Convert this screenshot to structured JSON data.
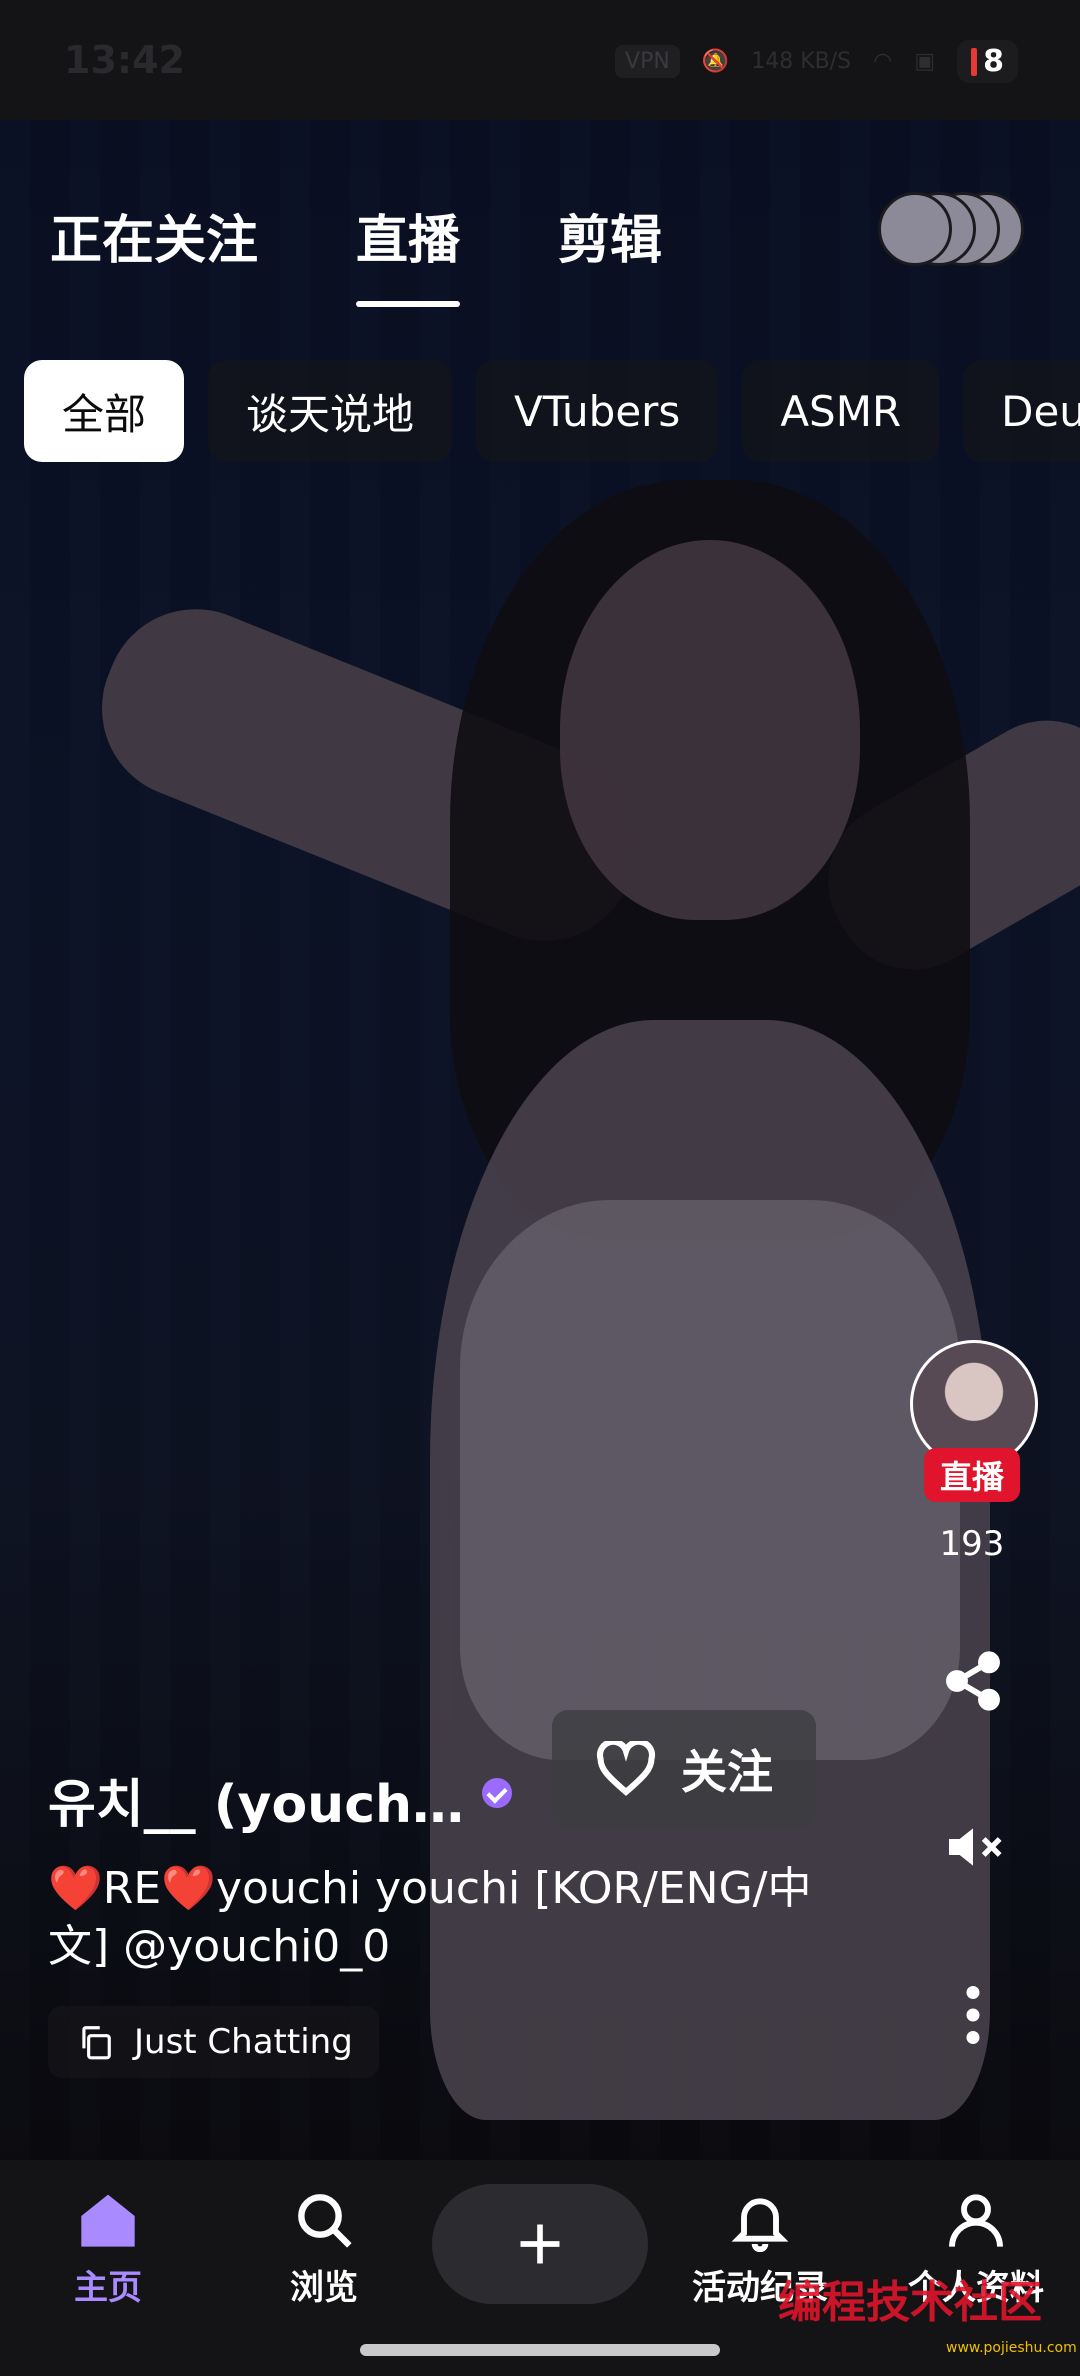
{
  "status_bar": {
    "time": "13:42",
    "vpn": "VPN",
    "net_speed": "148",
    "net_unit": "KB/S",
    "battery": "8"
  },
  "top_tabs": [
    {
      "label": "正在关注",
      "active": false
    },
    {
      "label": "直播",
      "active": true
    },
    {
      "label": "剪辑",
      "active": false
    }
  ],
  "categories": [
    {
      "label": "全部",
      "active": true
    },
    {
      "label": "谈天说地",
      "active": false
    },
    {
      "label": "VTubers",
      "active": false
    },
    {
      "label": "ASMR",
      "active": false
    },
    {
      "label": "Deu",
      "active": false
    }
  ],
  "stream": {
    "live_badge": "直播",
    "viewer_count": "193",
    "channel_name": "유치__ (youchi...",
    "follow_label": "关注",
    "title": "❤️RE❤️youchi youchi [KOR/ENG/中文] @youchi0_0",
    "category": "Just Chatting"
  },
  "bottom_nav": {
    "home": "主页",
    "browse": "浏览",
    "activity": "活动纪录",
    "profile": "个人资料"
  },
  "watermark": {
    "text": "编程技术社区",
    "url": "www.pojieshu.com"
  },
  "colors": {
    "accent": "#a98bff",
    "live": "#e0142c",
    "verified": "#9b6bff"
  },
  "icons": [
    "share-icon",
    "mute-icon",
    "more-icon",
    "heart-icon",
    "copy-icon",
    "home-icon",
    "search-icon",
    "plus-icon",
    "bell-icon",
    "profile-icon"
  ]
}
